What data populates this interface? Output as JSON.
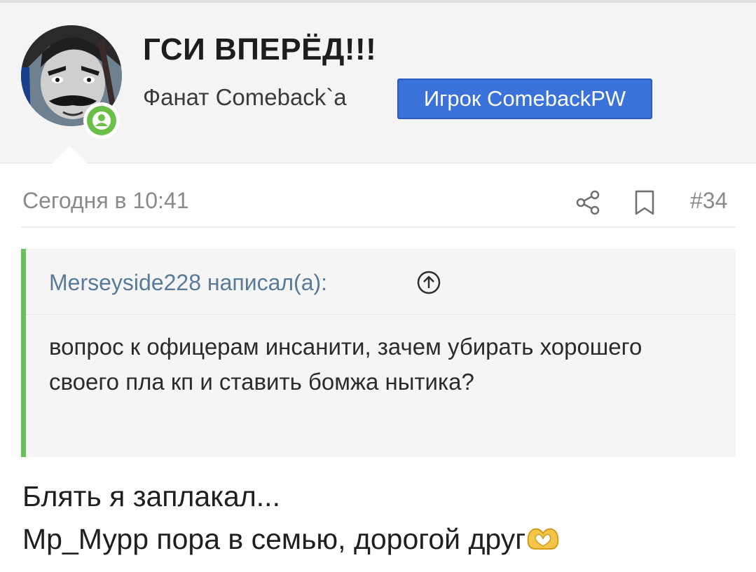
{
  "user": {
    "name": "ГСИ ВПЕРЁД!!!",
    "title": "Фанат Comeback`a",
    "banner": "Игрок ComebackPW",
    "online": true
  },
  "post": {
    "date": "Сегодня в 10:41",
    "number": "#34"
  },
  "quote": {
    "author": "Merseyside228 написал(а):",
    "text": "вопрос к офицерам инсанити, зачем убирать хорошего своего пла кп и ставить бомжа нытика?"
  },
  "message": {
    "line1": "Блять я заплакал...",
    "line2": "Mp_Мурр пора в семью, дорогой друг",
    "emoji": "heart-hands-emoji"
  },
  "icons": {
    "share": "share-icon",
    "bookmark": "bookmark-icon",
    "quote_jump": "arrow-up-circle-icon",
    "online": "user-online-icon"
  },
  "colors": {
    "banner": "#3a72d9",
    "quote_border": "#6abf5e",
    "online": "#6cc04a",
    "link": "#5a7a9a"
  }
}
